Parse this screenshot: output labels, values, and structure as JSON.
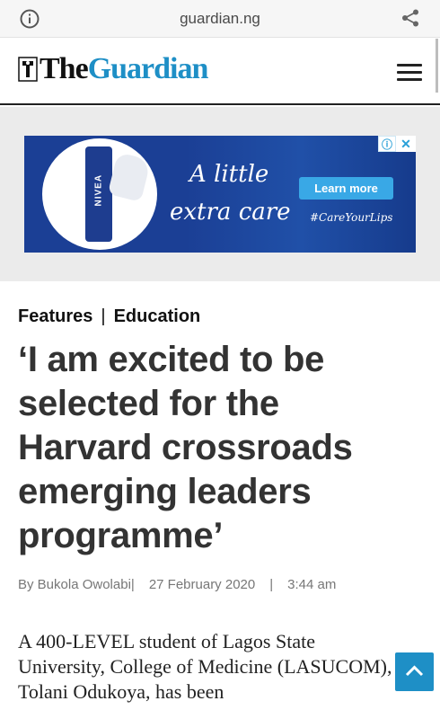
{
  "browser": {
    "url": "guardian.ng",
    "info_icon": "info-icon",
    "share_icon": "share-icon"
  },
  "header": {
    "logo_the": "The",
    "logo_guardian": "Guardian",
    "menu_icon": "hamburger-menu-icon",
    "brand_color": "#1e8fc6"
  },
  "ad": {
    "brand": "NIVEA",
    "tagline_line1": "A little",
    "tagline_line2": "extra care",
    "cta": "Learn more",
    "hashtag": "#CareYourLips",
    "adchoices_icon": "adchoices-icon",
    "close_icon": "close-icon",
    "background_color": "#1b3f95"
  },
  "article": {
    "category_1": "Features",
    "category_separator": "|",
    "category_2": "Education",
    "headline": "‘I am excited to be selected for the Harvard crossroads emerging leaders programme’",
    "author": "By Bukola Owolabi",
    "byline_sep_1": "|",
    "date": "27 February 2020",
    "byline_sep_2": "|",
    "time": "3:44 am",
    "body": "A 400-LEVEL student of Lagos State University, College of Medicine (LASUCOM), Tolani Odukoya, has been"
  },
  "back_to_top_icon": "chevron-up-icon"
}
